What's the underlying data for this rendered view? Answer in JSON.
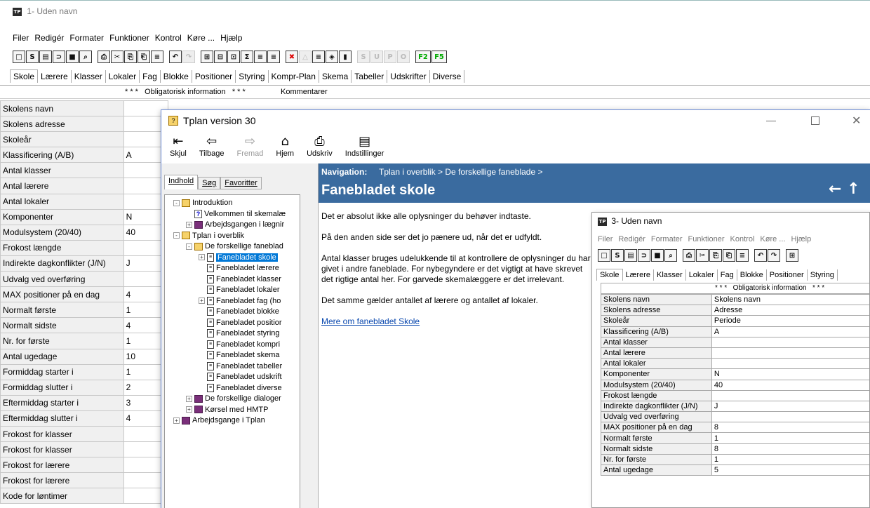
{
  "main_window": {
    "title": "1- Uden navn",
    "menu": [
      "Filer",
      "Redigér",
      "Formater",
      "Funktioner",
      "Kontrol",
      "Køre ...",
      "Hjælp"
    ],
    "toolbar_letters": [
      "S",
      "U",
      "P",
      "O",
      "F2",
      "F5"
    ],
    "tabs": [
      "Skole",
      "Lærere",
      "Klasser",
      "Lokaler",
      "Fag",
      "Blokke",
      "Positioner",
      "Styring",
      "Kompr-Plan",
      "Skema",
      "Tabeller",
      "Udskrifter",
      "Diverse"
    ],
    "header_text": "* * *   Obligatorisk information   * * *",
    "header_comment": "Kommentarer",
    "rows": [
      {
        "label": "Skolens navn",
        "value": ""
      },
      {
        "label": "Skolens adresse",
        "value": ""
      },
      {
        "label": "Skoleår",
        "value": ""
      },
      {
        "label": "Klassificering (A/B)",
        "value": "A"
      },
      {
        "label": "Antal klasser",
        "value": ""
      },
      {
        "label": "Antal lærere",
        "value": ""
      },
      {
        "label": "Antal lokaler",
        "value": ""
      },
      {
        "label": "Komponenter",
        "value": "N"
      },
      {
        "label": "Modulsystem (20/40)",
        "value": "40"
      },
      {
        "label": "Frokost længde",
        "value": ""
      },
      {
        "label": "Indirekte dagkonflikter (J/N)",
        "value": "J"
      },
      {
        "label": "Udvalg ved overføring",
        "value": ""
      },
      {
        "label": "MAX positioner på en dag",
        "value": "4"
      },
      {
        "label": "Normalt første",
        "value": "1"
      },
      {
        "label": "Normalt sidste",
        "value": "4"
      },
      {
        "label": "Nr. for første",
        "value": "1"
      },
      {
        "label": "Antal ugedage",
        "value": "10"
      },
      {
        "label": "Formiddag starter i",
        "value": "1"
      },
      {
        "label": "Formiddag slutter i",
        "value": "2"
      },
      {
        "label": "Eftermiddag starter i",
        "value": "3"
      },
      {
        "label": "Eftermiddag slutter i",
        "value": "4"
      },
      {
        "label": "Frokost for klasser",
        "value": ""
      },
      {
        "label": "Frokost for klasser",
        "value": ""
      },
      {
        "label": "Frokost for lærere",
        "value": ""
      },
      {
        "label": "Frokost for lærere",
        "value": ""
      },
      {
        "label": "Kode for løntimer",
        "value": ""
      }
    ]
  },
  "help_window": {
    "title": "Tplan version 30",
    "toolbar": [
      {
        "label": "Skjul",
        "icon": "⇤"
      },
      {
        "label": "Tilbage",
        "icon": "⇦"
      },
      {
        "label": "Fremad",
        "icon": "⇨"
      },
      {
        "label": "Hjem",
        "icon": "⌂"
      },
      {
        "label": "Udskriv",
        "icon": "⎙"
      },
      {
        "label": "Indstillinger",
        "icon": "▤"
      }
    ],
    "nav_tabs": [
      "Indhold",
      "Søg",
      "Favoritter"
    ],
    "tree": [
      {
        "text": "Introduktion",
        "level": 0,
        "icon": "book-open",
        "exp": "-"
      },
      {
        "text": "Velkommen til skemalæ",
        "level": 1,
        "icon": "help",
        "exp": ""
      },
      {
        "text": "Arbejdsgangen i lægnir",
        "level": 1,
        "icon": "book-closed",
        "exp": "+"
      },
      {
        "text": "Tplan i overblik",
        "level": 0,
        "icon": "book-open",
        "exp": "-"
      },
      {
        "text": "De forskellige faneblad",
        "level": 1,
        "icon": "book-open",
        "exp": "-"
      },
      {
        "text": "Fanebladet skole",
        "level": 2,
        "icon": "page",
        "exp": "+",
        "selected": true
      },
      {
        "text": "Fanebladet lærere",
        "level": 2,
        "icon": "page",
        "exp": ""
      },
      {
        "text": "Fanebladet klasser",
        "level": 2,
        "icon": "page",
        "exp": ""
      },
      {
        "text": "Fanebladet lokaler",
        "level": 2,
        "icon": "page",
        "exp": ""
      },
      {
        "text": "Fanebladet fag (ho",
        "level": 2,
        "icon": "page",
        "exp": "+"
      },
      {
        "text": "Fanebladet blokke",
        "level": 2,
        "icon": "page",
        "exp": ""
      },
      {
        "text": "Fanebladet positior",
        "level": 2,
        "icon": "page",
        "exp": ""
      },
      {
        "text": "Fanebladet styring",
        "level": 2,
        "icon": "page",
        "exp": ""
      },
      {
        "text": "Fanebladet kompri",
        "level": 2,
        "icon": "page",
        "exp": ""
      },
      {
        "text": "Fanebladet skema",
        "level": 2,
        "icon": "page",
        "exp": ""
      },
      {
        "text": "Fanebladet tabeller",
        "level": 2,
        "icon": "page",
        "exp": ""
      },
      {
        "text": "Fanebladet udskrift",
        "level": 2,
        "icon": "page",
        "exp": ""
      },
      {
        "text": "Fanebladet diverse",
        "level": 2,
        "icon": "page",
        "exp": ""
      },
      {
        "text": "De forskellige dialoger",
        "level": 1,
        "icon": "book-closed",
        "exp": "+"
      },
      {
        "text": "Kørsel med HMTP",
        "level": 1,
        "icon": "book-closed",
        "exp": "+"
      },
      {
        "text": "Arbejdsgange i Tplan",
        "level": 0,
        "icon": "book-closed",
        "exp": "+"
      }
    ],
    "breadcrumb_label": "Navigation:",
    "breadcrumb_path": "Tplan i overblik > De forskellige faneblade >",
    "page_title": "Fanebladet skole",
    "paragraphs": [
      "Det er absolut ikke alle oplysninger du behøver indtaste.",
      "På den anden side ser det jo pænere ud, når det er udfyldt.",
      "Antal klasser bruges udelukkende til at kontrollere de oplysninger du har givet i andre faneblade. For nybegyndere er det vigtigt at have skrevet det rigtige antal her. For garvede skemalæggere er det irrelevant.",
      "Det samme gælder antallet af lærere og antallet af lokaler."
    ],
    "link": "Mere om fanebladet Skole",
    "nav_arrows": "← ↑ →",
    "colors": {
      "header_bg": "#3a6b9f",
      "link": "#0645ad"
    }
  },
  "screenshot_window": {
    "title": "3- Uden navn",
    "menu": [
      "Filer",
      "Redigér",
      "Formater",
      "Funktioner",
      "Kontrol",
      "Køre ...",
      "Hjælp"
    ],
    "tabs": [
      "Skole",
      "Lærere",
      "Klasser",
      "Lokaler",
      "Fag",
      "Blokke",
      "Positioner",
      "Styring"
    ],
    "header_text": "* * *   Obligatorisk information   * * *",
    "rows": [
      {
        "label": "Skolens navn",
        "value": "Skolens navn"
      },
      {
        "label": "Skolens adresse",
        "value": "Adresse"
      },
      {
        "label": "Skoleår",
        "value": "Periode"
      },
      {
        "label": "Klassificering (A/B)",
        "value": "A"
      },
      {
        "label": "Antal klasser",
        "value": ""
      },
      {
        "label": "Antal lærere",
        "value": ""
      },
      {
        "label": "Antal lokaler",
        "value": ""
      },
      {
        "label": "Komponenter",
        "value": "N"
      },
      {
        "label": "Modulsystem (20/40)",
        "value": "40"
      },
      {
        "label": "Frokost længde",
        "value": ""
      },
      {
        "label": "Indirekte dagkonflikter (J/N)",
        "value": "J"
      },
      {
        "label": "Udvalg ved overføring",
        "value": ""
      },
      {
        "label": "MAX positioner på en dag",
        "value": "8"
      },
      {
        "label": "Normalt første",
        "value": "1"
      },
      {
        "label": "Normalt sidste",
        "value": "8"
      },
      {
        "label": "Nr. for første",
        "value": "1"
      },
      {
        "label": "Antal ugedage",
        "value": "5"
      }
    ]
  }
}
